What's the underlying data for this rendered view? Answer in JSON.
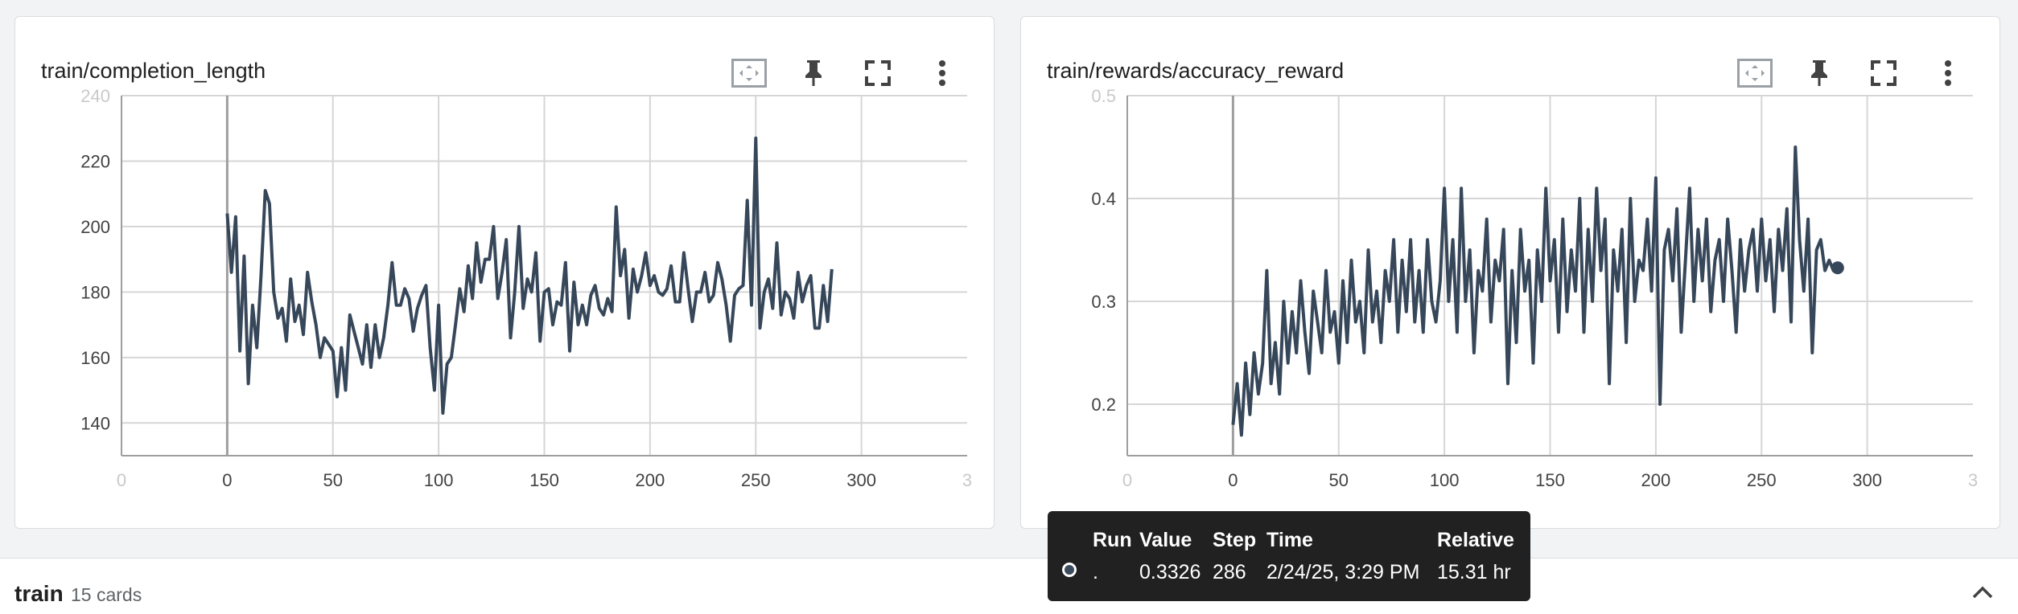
{
  "cards": [
    {
      "title": "train/completion_length",
      "toolbar": [
        "fit-domain-icon",
        "pin-icon",
        "fullscreen-icon",
        "more-vert-icon"
      ],
      "chart_data": {
        "type": "line",
        "xlabel": "",
        "ylabel": "",
        "xlim": [
          -50,
          350
        ],
        "ylim": [
          130,
          240
        ],
        "x_ticks": [
          "0",
          "0",
          "50",
          "100",
          "150",
          "200",
          "250",
          "300",
          "3"
        ],
        "y_ticks": [
          "240",
          "220",
          "200",
          "180",
          "160",
          "140"
        ],
        "grid": true,
        "line_color": "#37475a",
        "series": [
          {
            "x": [
              0,
              2,
              4,
              6,
              8,
              10,
              12,
              14,
              16,
              18,
              20,
              22,
              24,
              26,
              28,
              30,
              32,
              34,
              36,
              38,
              40,
              42,
              44,
              46,
              48,
              50,
              52,
              54,
              56,
              58,
              60,
              62,
              64,
              66,
              68,
              70,
              72,
              74,
              76,
              78,
              80,
              82,
              84,
              86,
              88,
              90,
              92,
              94,
              96,
              98,
              100,
              102,
              104,
              106,
              108,
              110,
              112,
              114,
              116,
              118,
              120,
              122,
              124,
              126,
              128,
              130,
              132,
              134,
              136,
              138,
              140,
              142,
              144,
              146,
              148,
              150,
              152,
              154,
              156,
              158,
              160,
              162,
              164,
              166,
              168,
              170,
              172,
              174,
              176,
              178,
              180,
              182,
              184,
              186,
              188,
              190,
              192,
              194,
              196,
              198,
              200,
              202,
              204,
              206,
              208,
              210,
              212,
              214,
              216,
              218,
              220,
              222,
              224,
              226,
              228,
              230,
              232,
              234,
              236,
              238,
              240,
              242,
              244,
              246,
              248,
              250,
              252,
              254,
              256,
              258,
              260,
              262,
              264,
              266,
              268,
              270,
              272,
              274,
              276,
              278,
              280,
              282,
              284,
              286
            ],
            "y": [
              204,
              186,
              203,
              162,
              191,
              152,
              176,
              163,
              185,
              211,
              207,
              180,
              172,
              175,
              165,
              184,
              171,
              176,
              167,
              186,
              177,
              170,
              160,
              166,
              164,
              162,
              148,
              163,
              150,
              173,
              168,
              163,
              158,
              170,
              157,
              170,
              160,
              166,
              176,
              189,
              176,
              176,
              181,
              178,
              168,
              175,
              179,
              182,
              163,
              150,
              176,
              143,
              158,
              160,
              170,
              181,
              174,
              188,
              178,
              195,
              183,
              190,
              190,
              200,
              178,
              186,
              196,
              166,
              180,
              200,
              175,
              184,
              180,
              192,
              165,
              180,
              181,
              170,
              177,
              176,
              189,
              162,
              183,
              170,
              176,
              170,
              179,
              182,
              175,
              173,
              178,
              174,
              206,
              185,
              193,
              172,
              187,
              180,
              185,
              192,
              182,
              185,
              180,
              179,
              181,
              188,
              177,
              177,
              192,
              181,
              171,
              180,
              180,
              186,
              177,
              179,
              189,
              184,
              176,
              165,
              179,
              181,
              182,
              208,
              176,
              227,
              169,
              180,
              184,
              175,
              195,
              173,
              180,
              178,
              172,
              186,
              177,
              182,
              185,
              169,
              169,
              182,
              171,
              187
            ]
          }
        ]
      }
    },
    {
      "title": "train/rewards/accuracy_reward",
      "toolbar": [
        "fit-domain-icon",
        "pin-icon",
        "fullscreen-icon",
        "more-vert-icon"
      ],
      "chart_data": {
        "type": "line",
        "xlabel": "",
        "ylabel": "",
        "xlim": [
          -50,
          350
        ],
        "ylim": [
          0.15,
          0.5
        ],
        "x_ticks": [
          "0",
          "0",
          "50",
          "100",
          "150",
          "200",
          "250",
          "300",
          "3"
        ],
        "y_ticks": [
          "0.5",
          "0.4",
          "0.3",
          "0.2"
        ],
        "grid": true,
        "line_color": "#37475a",
        "series": [
          {
            "x": [
              0,
              2,
              4,
              6,
              8,
              10,
              12,
              14,
              16,
              18,
              20,
              22,
              24,
              26,
              28,
              30,
              32,
              34,
              36,
              38,
              40,
              42,
              44,
              46,
              48,
              50,
              52,
              54,
              56,
              58,
              60,
              62,
              64,
              66,
              68,
              70,
              72,
              74,
              76,
              78,
              80,
              82,
              84,
              86,
              88,
              90,
              92,
              94,
              96,
              98,
              100,
              102,
              104,
              106,
              108,
              110,
              112,
              114,
              116,
              118,
              120,
              122,
              124,
              126,
              128,
              130,
              132,
              134,
              136,
              138,
              140,
              142,
              144,
              146,
              148,
              150,
              152,
              154,
              156,
              158,
              160,
              162,
              164,
              166,
              168,
              170,
              172,
              174,
              176,
              178,
              180,
              182,
              184,
              186,
              188,
              190,
              192,
              194,
              196,
              198,
              200,
              202,
              204,
              206,
              208,
              210,
              212,
              214,
              216,
              218,
              220,
              222,
              224,
              226,
              228,
              230,
              232,
              234,
              236,
              238,
              240,
              242,
              244,
              246,
              248,
              250,
              252,
              254,
              256,
              258,
              260,
              262,
              264,
              266,
              268,
              270,
              272,
              274,
              276,
              278,
              280,
              282,
              284,
              286
            ],
            "y": [
              0.18,
              0.22,
              0.17,
              0.24,
              0.19,
              0.25,
              0.21,
              0.24,
              0.33,
              0.22,
              0.26,
              0.21,
              0.3,
              0.24,
              0.29,
              0.25,
              0.32,
              0.27,
              0.23,
              0.31,
              0.28,
              0.25,
              0.33,
              0.27,
              0.29,
              0.24,
              0.32,
              0.26,
              0.34,
              0.28,
              0.3,
              0.25,
              0.35,
              0.28,
              0.31,
              0.26,
              0.33,
              0.3,
              0.36,
              0.27,
              0.34,
              0.29,
              0.36,
              0.28,
              0.33,
              0.27,
              0.36,
              0.3,
              0.28,
              0.32,
              0.41,
              0.3,
              0.36,
              0.27,
              0.41,
              0.3,
              0.35,
              0.25,
              0.33,
              0.31,
              0.38,
              0.28,
              0.34,
              0.32,
              0.37,
              0.22,
              0.33,
              0.26,
              0.37,
              0.31,
              0.34,
              0.24,
              0.35,
              0.3,
              0.41,
              0.32,
              0.36,
              0.27,
              0.38,
              0.29,
              0.35,
              0.31,
              0.4,
              0.27,
              0.37,
              0.3,
              0.41,
              0.33,
              0.38,
              0.22,
              0.35,
              0.31,
              0.37,
              0.26,
              0.4,
              0.3,
              0.34,
              0.33,
              0.38,
              0.31,
              0.42,
              0.2,
              0.35,
              0.37,
              0.32,
              0.39,
              0.27,
              0.34,
              0.41,
              0.3,
              0.37,
              0.32,
              0.38,
              0.29,
              0.34,
              0.36,
              0.3,
              0.38,
              0.33,
              0.27,
              0.36,
              0.31,
              0.35,
              0.37,
              0.31,
              0.38,
              0.32,
              0.36,
              0.29,
              0.37,
              0.33,
              0.39,
              0.28,
              0.45,
              0.36,
              0.31,
              0.38,
              0.25,
              0.35,
              0.36,
              0.33,
              0.34,
              0.33,
              0.3326
            ]
          }
        ]
      }
    }
  ],
  "tooltip": {
    "headers": [
      "Run",
      "Value",
      "Step",
      "Time",
      "Relative"
    ],
    "row": {
      "run": ".",
      "value": "0.3326",
      "step": "286",
      "time": "2/24/25, 3:29 PM",
      "relative": "15.31 hr"
    }
  },
  "bottom_bar": {
    "group_name": "train",
    "card_count": "15 cards"
  },
  "colors": {
    "line": "#37475a",
    "grid": "#d6d6d6",
    "axis": "#9e9e9e",
    "tooltip_bg": "#212121"
  }
}
